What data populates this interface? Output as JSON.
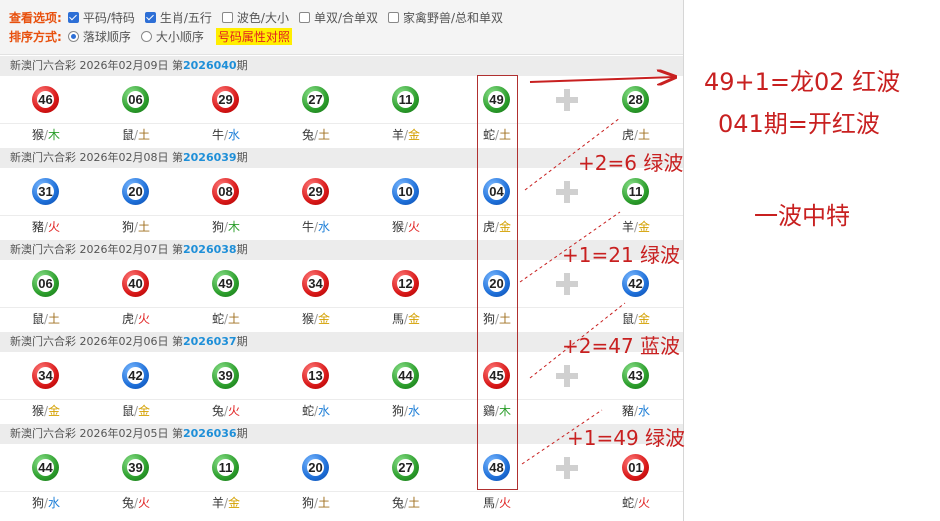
{
  "options": {
    "view_label": "查看选项:",
    "view_options": [
      {
        "label": "平码/特码",
        "checked": true
      },
      {
        "label": "生肖/五行",
        "checked": true
      },
      {
        "label": "波色/大小",
        "checked": false
      },
      {
        "label": "单双/合单双",
        "checked": false
      },
      {
        "label": "家禽野兽/总和单双",
        "checked": false
      }
    ],
    "sort_label": "排序方式:",
    "sort_options": [
      {
        "label": "落球顺序",
        "selected": true
      },
      {
        "label": "大小顺序",
        "selected": false
      }
    ],
    "highlight_link": "号码属性对照"
  },
  "draws": [
    {
      "prefix": "新澳门六合彩 2026年02月09日 第",
      "period": "2026040",
      "suffix": "期",
      "balls": [
        {
          "num": "46",
          "color": "red",
          "zodiac": "猴",
          "element": "木"
        },
        {
          "num": "06",
          "color": "green",
          "zodiac": "鼠",
          "element": "土"
        },
        {
          "num": "29",
          "color": "red",
          "zodiac": "牛",
          "element": "水"
        },
        {
          "num": "27",
          "color": "green",
          "zodiac": "兔",
          "element": "土"
        },
        {
          "num": "11",
          "color": "green",
          "zodiac": "羊",
          "element": "金"
        },
        {
          "num": "49",
          "color": "green",
          "zodiac": "蛇",
          "element": "土"
        },
        {
          "num": "28",
          "color": "green",
          "zodiac": "虎",
          "element": "土"
        }
      ]
    },
    {
      "prefix": "新澳门六合彩 2026年02月08日 第",
      "period": "2026039",
      "suffix": "期",
      "balls": [
        {
          "num": "31",
          "color": "blue",
          "zodiac": "豬",
          "element": "火"
        },
        {
          "num": "20",
          "color": "blue",
          "zodiac": "狗",
          "element": "土"
        },
        {
          "num": "08",
          "color": "red",
          "zodiac": "狗",
          "element": "木"
        },
        {
          "num": "29",
          "color": "red",
          "zodiac": "牛",
          "element": "水"
        },
        {
          "num": "10",
          "color": "blue",
          "zodiac": "猴",
          "element": "火"
        },
        {
          "num": "04",
          "color": "blue",
          "zodiac": "虎",
          "element": "金"
        },
        {
          "num": "11",
          "color": "green",
          "zodiac": "羊",
          "element": "金"
        }
      ]
    },
    {
      "prefix": "新澳门六合彩 2026年02月07日 第",
      "period": "2026038",
      "suffix": "期",
      "balls": [
        {
          "num": "06",
          "color": "green",
          "zodiac": "鼠",
          "element": "土"
        },
        {
          "num": "40",
          "color": "red",
          "zodiac": "虎",
          "element": "火"
        },
        {
          "num": "49",
          "color": "green",
          "zodiac": "蛇",
          "element": "土"
        },
        {
          "num": "34",
          "color": "red",
          "zodiac": "猴",
          "element": "金"
        },
        {
          "num": "12",
          "color": "red",
          "zodiac": "馬",
          "element": "金"
        },
        {
          "num": "20",
          "color": "blue",
          "zodiac": "狗",
          "element": "土"
        },
        {
          "num": "42",
          "color": "blue",
          "zodiac": "鼠",
          "element": "金"
        }
      ]
    },
    {
      "prefix": "新澳门六合彩 2026年02月06日 第",
      "period": "2026037",
      "suffix": "期",
      "balls": [
        {
          "num": "34",
          "color": "red",
          "zodiac": "猴",
          "element": "金"
        },
        {
          "num": "42",
          "color": "blue",
          "zodiac": "鼠",
          "element": "金"
        },
        {
          "num": "39",
          "color": "green",
          "zodiac": "兔",
          "element": "火"
        },
        {
          "num": "13",
          "color": "red",
          "zodiac": "蛇",
          "element": "水"
        },
        {
          "num": "44",
          "color": "green",
          "zodiac": "狗",
          "element": "水"
        },
        {
          "num": "45",
          "color": "red",
          "zodiac": "鷄",
          "element": "木"
        },
        {
          "num": "43",
          "color": "green",
          "zodiac": "豬",
          "element": "水"
        }
      ]
    },
    {
      "prefix": "新澳门六合彩 2026年02月05日 第",
      "period": "2026036",
      "suffix": "期",
      "balls": [
        {
          "num": "44",
          "color": "green",
          "zodiac": "狗",
          "element": "水"
        },
        {
          "num": "39",
          "color": "green",
          "zodiac": "兔",
          "element": "火"
        },
        {
          "num": "11",
          "color": "green",
          "zodiac": "羊",
          "element": "金"
        },
        {
          "num": "20",
          "color": "blue",
          "zodiac": "狗",
          "element": "土"
        },
        {
          "num": "27",
          "color": "green",
          "zodiac": "兔",
          "element": "土"
        },
        {
          "num": "48",
          "color": "blue",
          "zodiac": "馬",
          "element": "火"
        },
        {
          "num": "01",
          "color": "red",
          "zodiac": "蛇",
          "element": "火"
        }
      ]
    }
  ],
  "annotations": {
    "main1": "49+1=龙02 红波",
    "main2": "041期=开红波",
    "main3": "一波中特",
    "note1": "+2=6 绿波",
    "note2": "+1=21 绿波",
    "note3": "+2=47 蓝波",
    "note4": "+1=49 绿波"
  },
  "colors": {
    "red": "#d81818",
    "blue": "#1e6fd8",
    "green": "#2c9e2c",
    "accent_orange": "#e8500d",
    "period_blue": "#1e8fd8",
    "annotation_red": "#c82020"
  }
}
